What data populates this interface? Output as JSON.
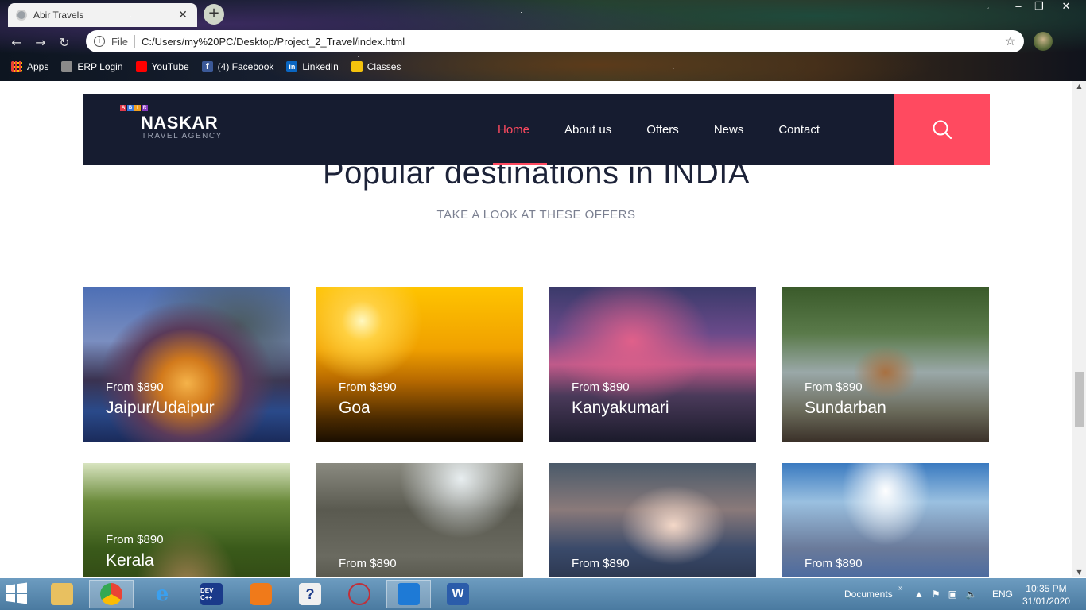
{
  "browser": {
    "tab_title": "Abir Travels",
    "tab_close": "✕",
    "new_tab": "+",
    "scheme": "File",
    "url": "C:/Users/my%20PC/Desktop/Project_2_Travel/index.html",
    "bookmarks": [
      {
        "label": "Apps",
        "icon": "apps-icon"
      },
      {
        "label": "ERP Login",
        "icon": "erp-icon"
      },
      {
        "label": "YouTube",
        "icon": "youtube-icon"
      },
      {
        "label": "(4) Facebook",
        "icon": "facebook-icon"
      },
      {
        "label": "LinkedIn",
        "icon": "linkedin-icon"
      },
      {
        "label": "Classes",
        "icon": "classes-icon"
      }
    ]
  },
  "site": {
    "logo_letters": [
      "A",
      "B",
      "I",
      "R"
    ],
    "brand": "NASKAR",
    "tagline": "TRAVEL AGENCY",
    "nav": [
      "Home",
      "About us",
      "Offers",
      "News",
      "Contact"
    ],
    "active_nav": "Home",
    "accent": "#ff4a60",
    "header_bg": "#161c30"
  },
  "section": {
    "title": "Popular destinations in INDIA",
    "subtitle": "TAKE A LOOK AT THESE OFFERS"
  },
  "destinations": [
    {
      "price": "From $890",
      "name": "Jaipur/Udaipur"
    },
    {
      "price": "From $890",
      "name": "Goa"
    },
    {
      "price": "From $890",
      "name": "Kanyakumari"
    },
    {
      "price": "From $890",
      "name": "Sundarban"
    },
    {
      "price": "From $890",
      "name": "Kerala"
    },
    {
      "price": "From $890",
      "name": ""
    },
    {
      "price": "From $890",
      "name": ""
    },
    {
      "price": "From $890",
      "name": ""
    }
  ],
  "taskbar": {
    "apps": [
      "file-explorer",
      "chrome",
      "internet-explorer",
      "dev-cpp",
      "xampp",
      "help",
      "network-app",
      "vscode",
      "word"
    ],
    "dev_label": "DEV C++",
    "word_label": "W",
    "documents_label": "Documents",
    "chevron": "»",
    "language": "ENG",
    "time": "10:35 PM",
    "date": "31/01/2020"
  }
}
